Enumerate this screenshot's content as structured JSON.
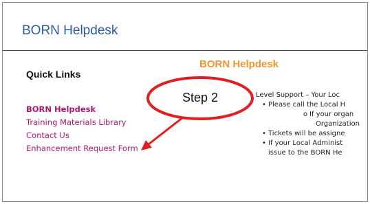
{
  "header": {
    "title": "BORN Helpdesk"
  },
  "sidebar": {
    "heading": "Quick Links",
    "items": [
      {
        "label": "BORN Helpdesk",
        "active": true
      },
      {
        "label": "Training Materials Library",
        "active": false
      },
      {
        "label": "Contact Us",
        "active": false
      },
      {
        "label": "Enhancement Request Form",
        "active": false
      }
    ]
  },
  "main": {
    "title": "BORN Helpdesk",
    "lines": [
      {
        "bullet": "",
        "text": "Level Support – Your Loc"
      },
      {
        "bullet": "•",
        "text": "Please call the Local H"
      },
      {
        "bullet": "o",
        "text": "If your organ"
      },
      {
        "bullet": "",
        "text": "Organization"
      },
      {
        "bullet": "•",
        "text": "Tickets will be assigne"
      },
      {
        "bullet": "•",
        "text": "If your Local Administ"
      },
      {
        "bullet": "",
        "text": "issue to the BORN He"
      }
    ]
  },
  "callout": {
    "label": "Step 2",
    "color": "#e31e1e"
  },
  "colors": {
    "header_title": "#2b5aa3",
    "nav_link": "#b0176e",
    "content_title": "#f0962b"
  }
}
